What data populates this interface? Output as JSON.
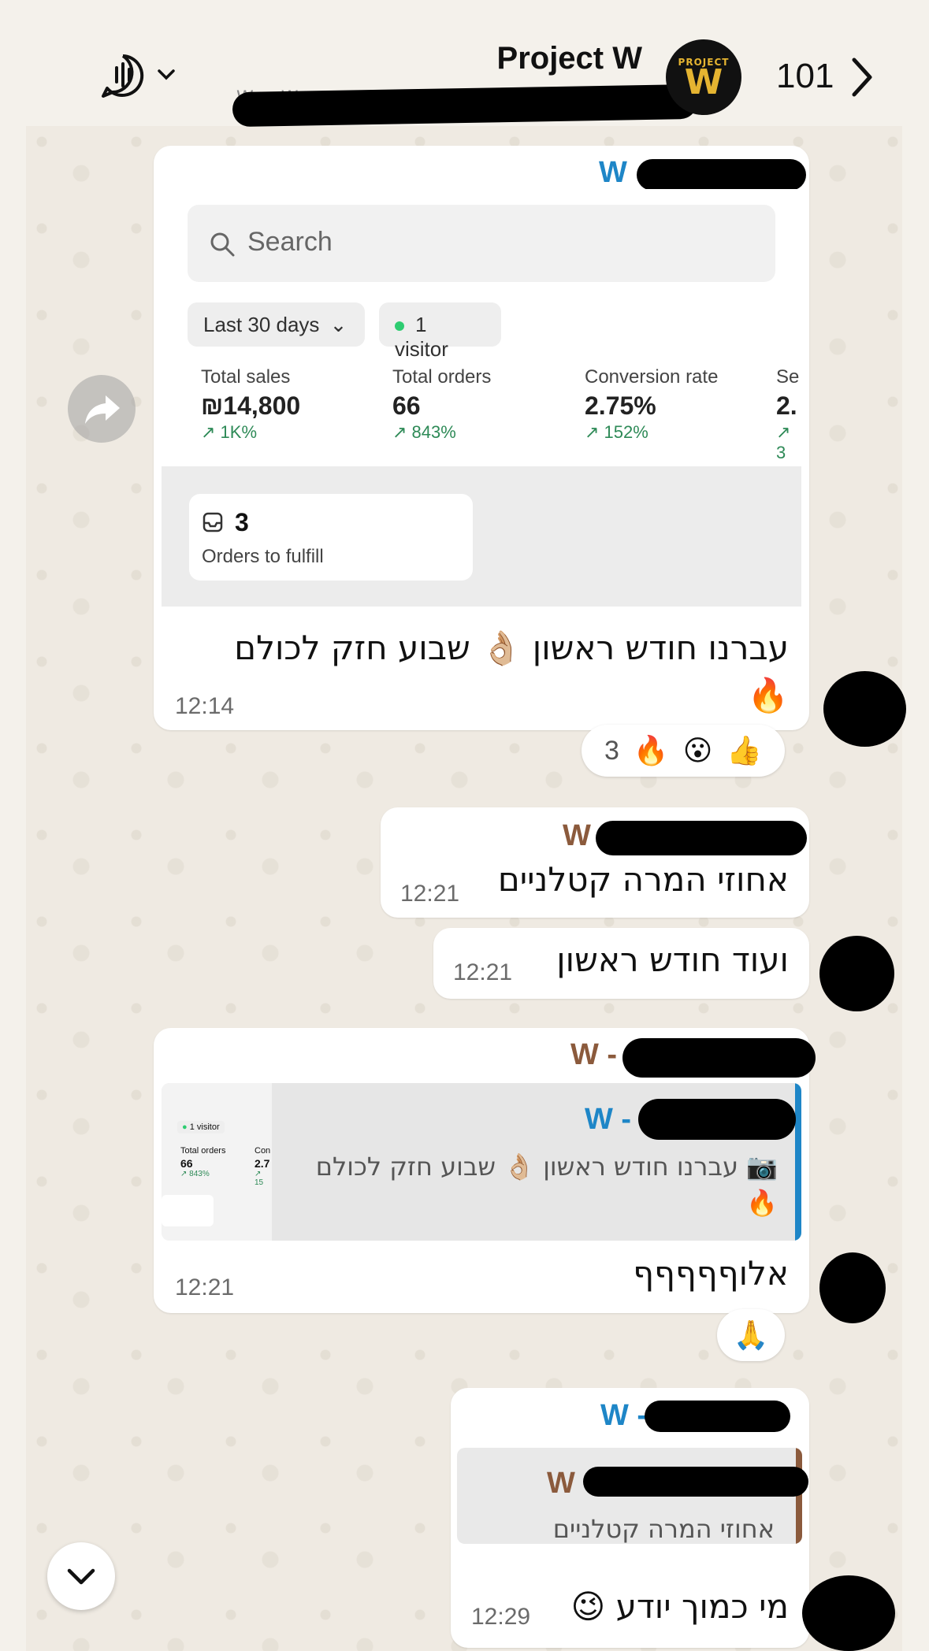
{
  "header": {
    "title": "Project W",
    "subtitle": "W ... W ...",
    "count": "101",
    "avatar_brand_top": "PROJECT",
    "avatar_brand_letter": "W"
  },
  "messages": [
    {
      "sender": "W",
      "sender_color": "#1e86c7",
      "shop": {
        "search_placeholder": "Search",
        "date_filter": "Last 30 days",
        "visitors": "1 visitor",
        "metrics": [
          {
            "label": "Total sales",
            "value": "₪14,800",
            "change": "↗ 1K%"
          },
          {
            "label": "Total orders",
            "value": "66",
            "change": "↗ 843%"
          },
          {
            "label": "Conversion rate",
            "value": "2.75%",
            "change": "↗ 152%"
          },
          {
            "label": "Se",
            "value": "2.",
            "change": "↗ 3"
          }
        ],
        "fulfill_count": "3",
        "fulfill_label": "Orders to fulfill"
      },
      "text": "עברנו חודש ראשון 👌🏼 שבוע חזק לכולם",
      "text2": "🔥",
      "time": "12:14",
      "reactions": {
        "emojis": [
          "👍",
          "😮",
          "🔥"
        ],
        "count": "3"
      }
    },
    {
      "sender": "W",
      "sender_color": "#8b5a3c",
      "text": "אחוזי המרה קטלניים",
      "time": "12:21"
    },
    {
      "text": "ועוד חודש ראשון",
      "time": "12:21"
    },
    {
      "sender": "W -",
      "sender_color": "#8b5a3c",
      "quote": {
        "sender": "W -",
        "sender_color": "#1e86c7",
        "text": "📷 עברנו חודש ראשון 👌🏼 שבוע חזק לכולם",
        "text2": "🔥",
        "thumb_visitor": "1 visitor",
        "thumb_orders_label": "Total orders",
        "thumb_orders_value": "66",
        "thumb_orders_change": "↗ 843%",
        "thumb_conv_label": "Con",
        "thumb_conv_value": "2.7",
        "thumb_conv_change": "↗ 15"
      },
      "text": "אלוףףףףף",
      "time": "12:21",
      "reaction": "🙏"
    },
    {
      "sender": "W -",
      "sender_color": "#1e86c7",
      "quote": {
        "sender": "W",
        "sender_color": "#8b5a3c",
        "text": "אחוזי המרה קטלניים"
      },
      "text": "מי כמוך יודע 😉",
      "time": "12:29"
    }
  ]
}
